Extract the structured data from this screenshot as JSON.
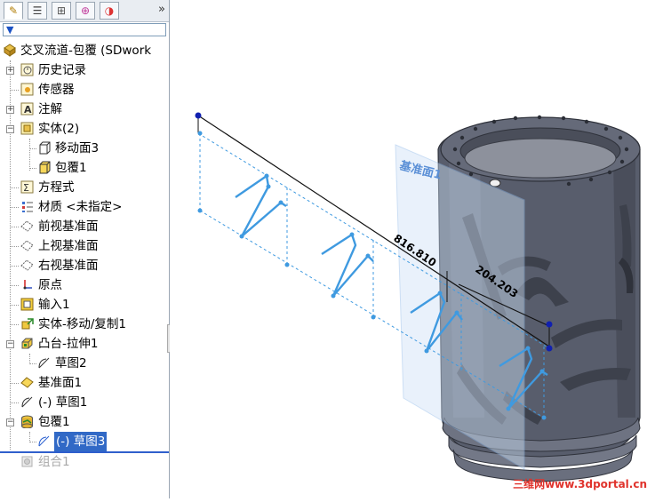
{
  "feature_tree": {
    "root": "交叉流道-包覆 (SDwork",
    "items": [
      {
        "label": "历史记录",
        "icon": "history-icon"
      },
      {
        "label": "传感器",
        "icon": "sensor-icon"
      },
      {
        "label": "注解",
        "icon": "annotation-icon"
      },
      {
        "label": "实体(2)",
        "icon": "solid-bodies-icon"
      },
      {
        "label": "移动面3",
        "icon": "body-icon"
      },
      {
        "label": "包覆1",
        "icon": "body-icon"
      },
      {
        "label": "方程式",
        "icon": "equations-icon"
      },
      {
        "label": "材质 <未指定>",
        "icon": "material-icon"
      },
      {
        "label": "前视基准面",
        "icon": "plane-icon"
      },
      {
        "label": "上视基准面",
        "icon": "plane-icon"
      },
      {
        "label": "右视基准面",
        "icon": "plane-icon"
      },
      {
        "label": "原点",
        "icon": "origin-icon"
      },
      {
        "label": "输入1",
        "icon": "import-icon"
      },
      {
        "label": "实体-移动/复制1",
        "icon": "move-copy-icon"
      },
      {
        "label": "凸台-拉伸1",
        "icon": "extrude-icon"
      },
      {
        "label": "草图2",
        "icon": "sketch-icon"
      },
      {
        "label": "基准面1",
        "icon": "plane-icon"
      },
      {
        "label": "(-) 草图1",
        "icon": "sketch-icon"
      },
      {
        "label": "包覆1",
        "icon": "wrap-icon"
      },
      {
        "label": "(-) 草图3",
        "icon": "sketch-icon"
      },
      {
        "label": "组合1",
        "icon": "combine-icon"
      }
    ]
  },
  "viewport": {
    "plane_label": "基准面1",
    "dimension_long": "816.810",
    "dimension_short": "204.203"
  },
  "watermark": "三维网www.3dportal.cn",
  "colors": {
    "selection": "#3169c6",
    "sketch": "#3f9ae0",
    "part": "#5c6273",
    "plane": "#9ec3ee"
  }
}
